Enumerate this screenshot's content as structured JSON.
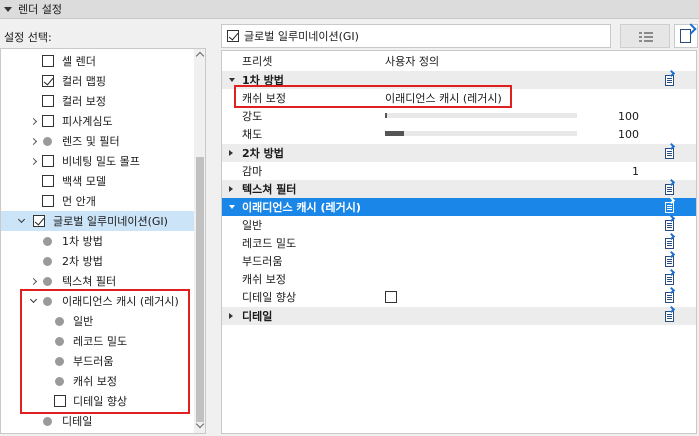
{
  "panel": {
    "title": "렌더 설정"
  },
  "left": {
    "label": "설정 선택:",
    "tree": [
      {
        "label": "셀 렌더",
        "checked": false
      },
      {
        "label": "컬러 맵핑",
        "checked": true
      },
      {
        "label": "컬러 보정",
        "checked": false
      },
      {
        "label": "피사계심도",
        "checked": false
      },
      {
        "label": "렌즈 및 필터"
      },
      {
        "label": "비네팅 밀도 몰프"
      },
      {
        "label": "백색 모델",
        "checked": false
      },
      {
        "label": "먼 안개",
        "checked": false
      },
      {
        "label": "글로벌 일루미네이션(GI)",
        "checked": true
      },
      {
        "label": "1차 방법"
      },
      {
        "label": "2차 방법"
      },
      {
        "label": "텍스쳐 필터"
      },
      {
        "label": "이래디언스 캐시 (레거시)"
      },
      {
        "label": "일반"
      },
      {
        "label": "레코드 밀도"
      },
      {
        "label": "부드러움"
      },
      {
        "label": "캐쉬 보정"
      },
      {
        "label": "디테일 향상",
        "checked": false
      },
      {
        "label": "디테일"
      }
    ]
  },
  "right": {
    "header_label": "글로벌 일루미네이션(GI)",
    "header_checked": true,
    "rows": {
      "preset": {
        "name": "프리셋",
        "value": "사용자 정의"
      },
      "g1": {
        "name": "1차 방법"
      },
      "cache_fix": {
        "name": "캐쉬 보정",
        "value": "이래디언스 캐시 (레거시)"
      },
      "intensity": {
        "name": "강도",
        "value": "100",
        "level": 0.01
      },
      "saturation": {
        "name": "채도",
        "value": "100",
        "level": 0.1
      },
      "g2": {
        "name": "2차 방법"
      },
      "gamma": {
        "name": "감마",
        "value": "1"
      },
      "g_texture": {
        "name": "텍스쳐 필터"
      },
      "g_irradiance": {
        "name": "이래디언스 캐시 (레거시)"
      },
      "general": {
        "name": "일반"
      },
      "record_density": {
        "name": "레코드 밀도"
      },
      "smoothness": {
        "name": "부드러움"
      },
      "cache_correction": {
        "name": "캐쉬 보정"
      },
      "detail_enhance": {
        "name": "디테일 향상",
        "checked": false
      },
      "g_detail": {
        "name": "디테일"
      }
    }
  }
}
